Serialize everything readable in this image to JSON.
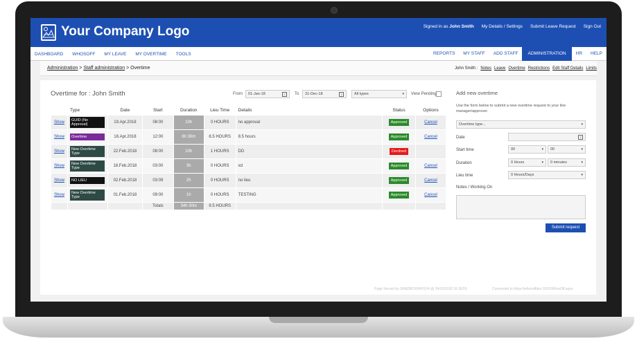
{
  "header": {
    "logo_text": "Your Company Logo",
    "signed_in_prefix": "Signed in as",
    "signed_in_user": "John Smith",
    "links": [
      "My Details / Settings",
      "Submit Leave Request",
      "Sign Out"
    ]
  },
  "nav": {
    "left": [
      "DASHBOARD",
      "WHOSOFF",
      "MY LEAVE",
      "MY OVERTIME",
      "TOOLS"
    ],
    "right": [
      "REPORTS",
      "MY STAFF",
      "ADD STAFF",
      "ADMINISTRATION",
      "HR",
      "HELP"
    ],
    "active": "ADMINISTRATION"
  },
  "breadcrumb": {
    "admin": "Administration",
    "sep1": " > ",
    "staff": "Staff administration",
    "sep2": " > ",
    "current": "Overtime"
  },
  "user_links": {
    "prefix": "John Smith :",
    "items": [
      "Notes",
      "Leave",
      "Overtime",
      "Restrictions",
      "Edit Staff Details",
      "Limits"
    ]
  },
  "overtime": {
    "title": "Overtime for : John Smith",
    "from_label": "From",
    "from_value": "01-Jan-18",
    "to_label": "To",
    "to_value": "31-Dec-18",
    "type_filter": "All types",
    "view_pending": "View Pending",
    "columns": [
      "",
      "Type",
      "Date",
      "Start",
      "Duration",
      "Lieu Time",
      "Details",
      "Status",
      "Options"
    ],
    "rows": [
      {
        "show": "Show",
        "type": "GUID (No Approval)",
        "type_color": "#111111",
        "date": "19.Apr.2018",
        "start": "08:00",
        "duration": "10h",
        "lieu": "0 HOURS",
        "details": "no approval",
        "status": "Approved",
        "option": "Cancel"
      },
      {
        "show": "Show",
        "type": "Overtime",
        "type_color": "#7a2a9a",
        "date": "18.Apr.2018",
        "start": "12:00",
        "duration": "8h 30m",
        "lieu": "8.5 HOURS",
        "details": "8.5 hours",
        "status": "Approved",
        "option": "Cancel"
      },
      {
        "show": "Show",
        "type": "New Overtime Type",
        "type_color": "#2e4a44",
        "date": "22.Feb.2018",
        "start": "08:00",
        "duration": "10h",
        "lieu": "1 HOURS",
        "details": "DD",
        "status": "Declined",
        "option": ""
      },
      {
        "show": "Show",
        "type": "New Overtime Type",
        "type_color": "#2e4a44",
        "date": "18.Feb.2018",
        "start": "03:00",
        "duration": "3h",
        "lieu": "0 HOURS",
        "details": "xd",
        "status": "Approved",
        "option": "Cancel"
      },
      {
        "show": "Show",
        "type": "NO LIEU",
        "type_color": "#111111",
        "date": "02.Feb.2018",
        "start": "03:09",
        "duration": "2h",
        "lieu": "0 HOURS",
        "details": "no lieu",
        "status": "Approved",
        "option": "Cancel"
      },
      {
        "show": "Show",
        "type": "New Overtime Type",
        "type_color": "#2e4a44",
        "date": "01.Feb.2018",
        "start": "09:00",
        "duration": "1h",
        "lieu": "0 HOURS",
        "details": "TESTING",
        "status": "Approved",
        "option": "Cancel"
      }
    ],
    "totals_label": "Totals",
    "totals_duration": "34h 30m",
    "totals_lieu": "9.5 HOURS"
  },
  "add_form": {
    "title": "Add new overtime",
    "description": "Use the form below to submit a new overtime request to your line manager/approver.",
    "type_select": "Overtime type...",
    "date_label": "Date",
    "start_label": "Start time",
    "start_hour": "00",
    "start_min": "00",
    "duration_label": "Duration",
    "duration_hours": "0 Hours",
    "duration_minutes": "0 minutes",
    "lieu_label": "Lieu time",
    "lieu_value": "0 Hours/Days",
    "notes_label": "Notes / Working On",
    "submit": "Submit request"
  },
  "footer": {
    "served": "Page Served by SANDBOX/WKS24 @ 24/10/2018 16:18:59",
    "connected": "Connected to https://whosoffdev:1002/WhosOff.aspx"
  },
  "colors": {
    "brand": "#1d4fb3",
    "approved": "#2a8a2a",
    "declined": "#e61919"
  }
}
